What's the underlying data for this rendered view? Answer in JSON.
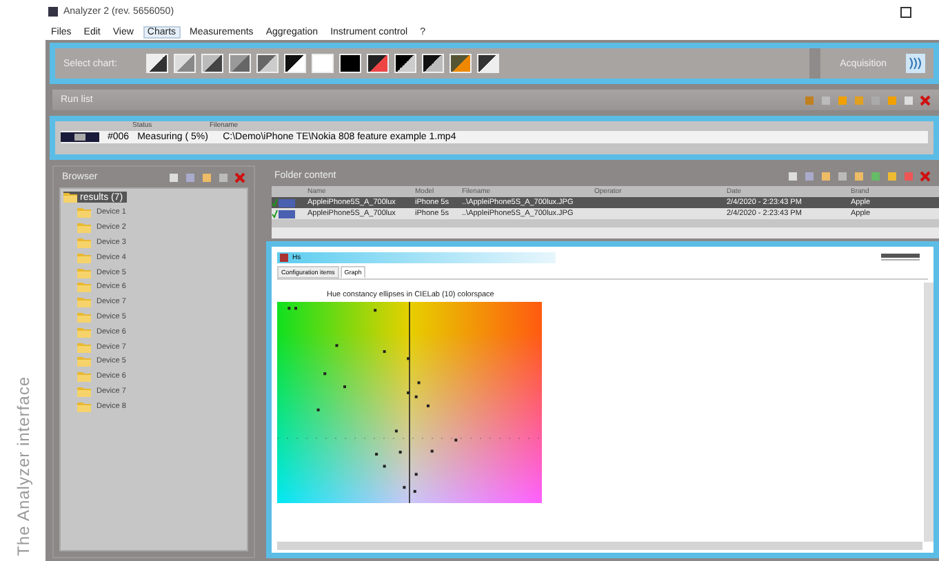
{
  "caption": "The Analyzer interface",
  "window": {
    "title": "Analyzer 2 (rev. 5656050)"
  },
  "menu": [
    {
      "label": "Files",
      "selected": false
    },
    {
      "label": "Edit",
      "selected": false
    },
    {
      "label": "View",
      "selected": false
    },
    {
      "label": "Charts",
      "selected": true
    },
    {
      "label": "Measurements",
      "selected": false
    },
    {
      "label": "Aggregation",
      "selected": false
    },
    {
      "label": "Instrument control",
      "selected": false
    },
    {
      "label": "?",
      "selected": false
    }
  ],
  "chart_toolbar": {
    "label": "Select chart:",
    "action": "Acquisition"
  },
  "run_list": {
    "title": "Run list",
    "columns": [
      "Status",
      "Filename"
    ],
    "rows": [
      {
        "number": "#006",
        "status": "Measuring (   5%)",
        "filename": "C:\\Demo\\iPhone TE\\Nokia 808 feature example 1.mp4"
      }
    ]
  },
  "browser": {
    "title": "Browser",
    "root": {
      "label": "results (7)",
      "selected": true,
      "children": [
        {
          "label": "Device 1"
        },
        {
          "label": "Device 2"
        },
        {
          "label": "Device 3"
        },
        {
          "label": "Device 4"
        },
        {
          "label": "Device 5"
        },
        {
          "label": "Device 6"
        },
        {
          "label": "Device 7"
        },
        {
          "label": "Device 5"
        },
        {
          "label": "Device 6"
        },
        {
          "label": "Device 7"
        },
        {
          "label": "Device 5"
        },
        {
          "label": "Device 6"
        },
        {
          "label": "Device 7"
        },
        {
          "label": "Device 8"
        }
      ]
    }
  },
  "folder_content": {
    "title": "Folder content",
    "columns": [
      "Name",
      "Model",
      "Filename",
      "Operator",
      "Date",
      "Brand"
    ],
    "rows": [
      {
        "checked": true,
        "selected": true,
        "cells": [
          "AppleiPhone5S_A_700lux",
          "iPhone 5s",
          "..\\AppleiPhone5S_A_700lux.JPG",
          "",
          "2/4/2020 - 2:23:43 PM",
          "Apple"
        ]
      },
      {
        "checked": true,
        "selected": false,
        "cells": [
          "AppleiPhone5S_A_700lux",
          "iPhone 5s",
          "..\\AppleiPhone5S_A_700lux.JPG",
          "",
          "2/4/2020 - 2:23:43 PM",
          "Apple"
        ]
      }
    ]
  },
  "report": {
    "header": "Hs",
    "tabs": [
      {
        "label": "Configuration items",
        "selected": false
      },
      {
        "label": "Graph",
        "selected": true
      }
    ],
    "chart_title": "Hue constancy ellipses in CIELab (10) colorspace"
  }
}
